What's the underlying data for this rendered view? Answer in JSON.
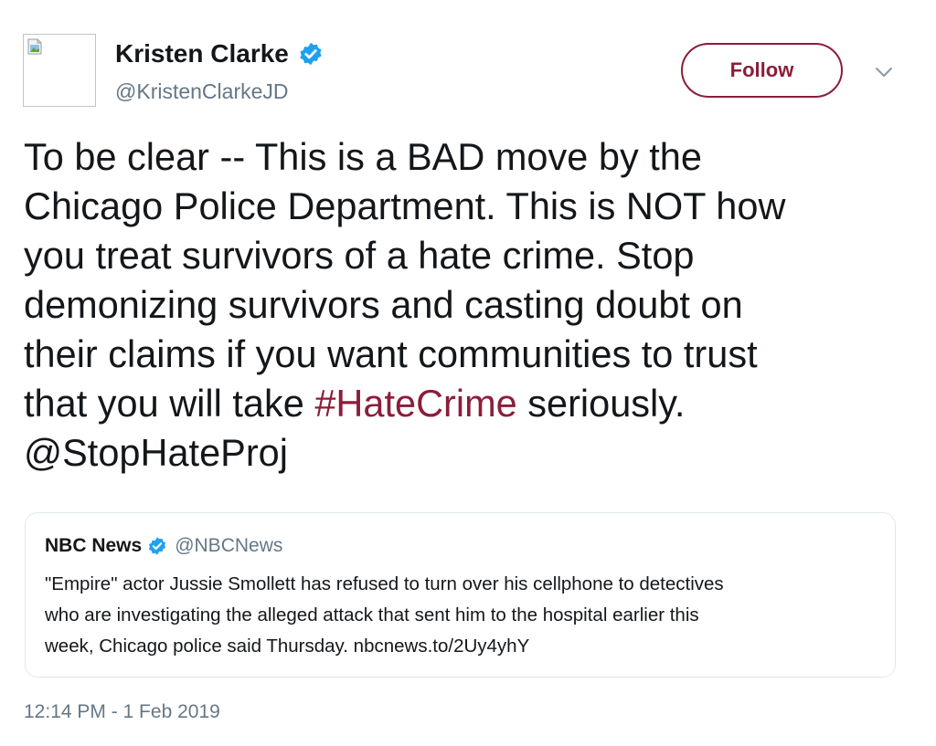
{
  "author": {
    "name": "Kristen Clarke",
    "handle": "@KristenClarkeJD",
    "verified": true
  },
  "actions": {
    "follow_label": "Follow"
  },
  "tweet": {
    "text_before": "To be clear -- This is a BAD move by the\nChicago Police Department. This is NOT how\nyou treat survivors of a hate crime. Stop\ndemonizing survivors and casting doubt on\ntheir claims if you want communities to trust\nthat you will take ",
    "hashtag": "#HateCrime",
    "text_after": " seriously.\n",
    "mention": "@StopHateProj"
  },
  "quoted_tweet": {
    "name": "NBC News",
    "handle": "@NBCNews",
    "verified": true,
    "text": "\"Empire\" actor Jussie Smollett has refused to turn over his cellphone to detectives\nwho are investigating the alleged attack that sent him to the hospital earlier this\nweek, Chicago police said Thursday. nbcnews.to/2Uy4yhY"
  },
  "timestamp": "12:14 PM - 1 Feb 2019",
  "colors": {
    "accent": "#8c1d3a",
    "verified_blue": "#1da1f2",
    "secondary_text": "#657786",
    "border": "#e1e8ed"
  },
  "icons": {
    "avatar": "broken-image-icon",
    "verified": "verified-badge-icon",
    "menu": "chevron-down-icon"
  }
}
